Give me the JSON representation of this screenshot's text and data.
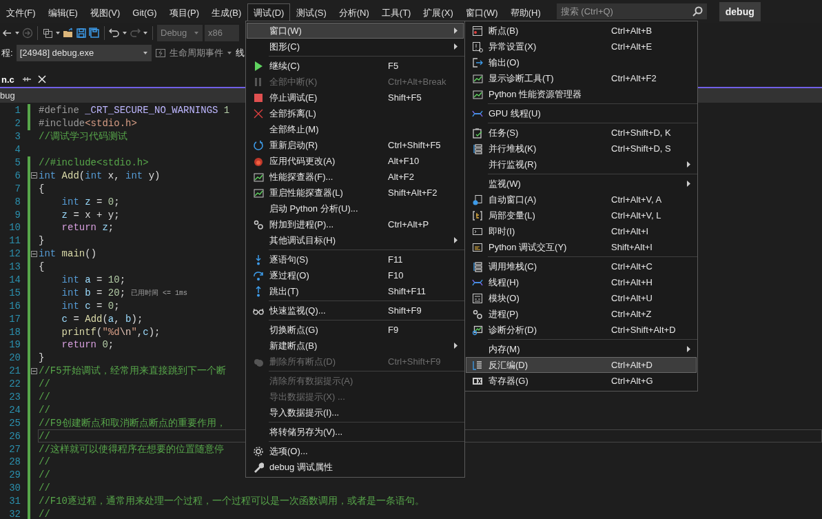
{
  "menu_bar": {
    "items": [
      {
        "label": "文件(F)",
        "selected": false
      },
      {
        "label": "编辑(E)",
        "selected": false
      },
      {
        "label": "视图(V)",
        "selected": false
      },
      {
        "label": "Git(G)",
        "selected": false
      },
      {
        "label": "项目(P)",
        "selected": false
      },
      {
        "label": "生成(B)",
        "selected": false
      },
      {
        "label": "调试(D)",
        "selected": true
      },
      {
        "label": "测试(S)",
        "selected": false
      },
      {
        "label": "分析(N)",
        "selected": false
      },
      {
        "label": "工具(T)",
        "selected": false
      },
      {
        "label": "扩展(X)",
        "selected": false
      },
      {
        "label": "窗口(W)",
        "selected": false
      },
      {
        "label": "帮助(H)",
        "selected": false
      }
    ],
    "search": {
      "placeholder": "搜索 (Ctrl+Q)"
    },
    "solution": "debug"
  },
  "toolbar": {
    "buttons": [
      {
        "kind": "back",
        "disabled": false
      },
      {
        "kind": "forward",
        "disabled": true
      },
      {
        "kind": "new-project",
        "disabled": false
      },
      {
        "kind": "open",
        "disabled": false
      },
      {
        "kind": "save",
        "disabled": false
      },
      {
        "kind": "save-all",
        "disabled": false
      },
      {
        "kind": "undo",
        "disabled": false
      },
      {
        "kind": "redo",
        "disabled": true
      }
    ],
    "configuration": {
      "value": "Debug",
      "disabled": true
    },
    "platform": {
      "value": "x86",
      "disabled": true
    }
  },
  "debug_toolbar": {
    "process_label": "程:",
    "process": "[24948] debug.exe",
    "lifecycle": "生命周期事件",
    "thread_label": "线"
  },
  "tab": {
    "title": "n.c",
    "path": "bug"
  },
  "editor": {
    "lines": [
      {
        "n": "1",
        "changed": true,
        "fold": false,
        "current": false,
        "tokens": [
          {
            "text": "#define ",
            "kind": "pp"
          },
          {
            "text": "_CRT_SECURE_NO_WARNINGS",
            "kind": "macro"
          },
          {
            "text": " 1",
            "kind": "num"
          }
        ]
      },
      {
        "n": "2",
        "changed": true,
        "fold": false,
        "current": false,
        "tokens": [
          {
            "text": "#include",
            "kind": "pp"
          },
          {
            "text": "<stdio.h>",
            "kind": "str"
          }
        ]
      },
      {
        "n": "3",
        "changed": false,
        "fold": false,
        "current": false,
        "tokens": [
          {
            "text": "//调试学习代码测试",
            "kind": "cmt"
          }
        ]
      },
      {
        "n": "4",
        "changed": false,
        "fold": false,
        "current": false
      },
      {
        "n": "5",
        "changed": true,
        "fold": false,
        "current": false,
        "tokens": [
          {
            "text": "//#include<stdio.h>",
            "kind": "cmt"
          }
        ]
      },
      {
        "n": "6",
        "changed": true,
        "fold": true,
        "current": false,
        "tokens": [
          {
            "text": "int",
            "kind": "kw"
          },
          {
            "text": " Add",
            "kind": "fn"
          },
          {
            "text": "(",
            "kind": "plain"
          },
          {
            "text": "int",
            "kind": "kw"
          },
          {
            "text": " x, ",
            "kind": "plain"
          },
          {
            "text": "int",
            "kind": "kw"
          },
          {
            "text": " y)",
            "kind": "plain"
          }
        ]
      },
      {
        "n": "7",
        "changed": true,
        "fold": false,
        "current": false,
        "tokens": [
          {
            "text": "{",
            "kind": "plain"
          }
        ]
      },
      {
        "n": "8",
        "changed": true,
        "fold": false,
        "current": false,
        "tokens": [
          {
            "text": "    int",
            "kind": "kw"
          },
          {
            "text": " z",
            "kind": "var"
          },
          {
            "text": " = ",
            "kind": "plain"
          },
          {
            "text": "0",
            "kind": "num"
          },
          {
            "text": ";",
            "kind": "plain"
          }
        ]
      },
      {
        "n": "9",
        "changed": true,
        "fold": false,
        "current": false,
        "tokens": [
          {
            "text": "    z",
            "kind": "var"
          },
          {
            "text": " = x + y;",
            "kind": "plain"
          }
        ]
      },
      {
        "n": "10",
        "changed": true,
        "fold": false,
        "current": false,
        "tokens": [
          {
            "text": "    return",
            "kind": "ctl"
          },
          {
            "text": " z",
            "kind": "var"
          },
          {
            "text": ";",
            "kind": "plain"
          }
        ]
      },
      {
        "n": "11",
        "changed": true,
        "fold": false,
        "current": false,
        "tokens": [
          {
            "text": "}",
            "kind": "plain"
          }
        ]
      },
      {
        "n": "12",
        "changed": true,
        "fold": true,
        "current": false,
        "tokens": [
          {
            "text": "int",
            "kind": "kw"
          },
          {
            "text": " main",
            "kind": "fn"
          },
          {
            "text": "()",
            "kind": "plain"
          }
        ]
      },
      {
        "n": "13",
        "changed": true,
        "fold": false,
        "current": false,
        "tokens": [
          {
            "text": "{",
            "kind": "plain"
          }
        ]
      },
      {
        "n": "14",
        "changed": true,
        "fold": false,
        "current": false,
        "tokens": [
          {
            "text": "    int",
            "kind": "kw"
          },
          {
            "text": " a",
            "kind": "var"
          },
          {
            "text": " = ",
            "kind": "plain"
          },
          {
            "text": "10",
            "kind": "num"
          },
          {
            "text": ";",
            "kind": "plain"
          }
        ]
      },
      {
        "n": "15",
        "changed": true,
        "fold": false,
        "current": false,
        "hint": "已用时间 <= 1ms",
        "tokens": [
          {
            "text": "    int",
            "kind": "kw"
          },
          {
            "text": " b",
            "kind": "var"
          },
          {
            "text": " = ",
            "kind": "plain"
          },
          {
            "text": "20",
            "kind": "num"
          },
          {
            "text": ";",
            "kind": "plain"
          }
        ]
      },
      {
        "n": "16",
        "changed": true,
        "fold": false,
        "current": false,
        "tokens": [
          {
            "text": "    int",
            "kind": "kw"
          },
          {
            "text": " c",
            "kind": "var"
          },
          {
            "text": " = ",
            "kind": "plain"
          },
          {
            "text": "0",
            "kind": "num"
          },
          {
            "text": ";",
            "kind": "plain"
          }
        ]
      },
      {
        "n": "17",
        "changed": true,
        "fold": false,
        "current": false,
        "tokens": [
          {
            "text": "    c",
            "kind": "var"
          },
          {
            "text": " = ",
            "kind": "plain"
          },
          {
            "text": "Add",
            "kind": "fn"
          },
          {
            "text": "(",
            "kind": "plain"
          },
          {
            "text": "a",
            "kind": "var"
          },
          {
            "text": ", ",
            "kind": "plain"
          },
          {
            "text": "b",
            "kind": "var"
          },
          {
            "text": ");",
            "kind": "plain"
          }
        ]
      },
      {
        "n": "18",
        "changed": true,
        "fold": false,
        "current": false,
        "tokens": [
          {
            "text": "    printf",
            "kind": "fn"
          },
          {
            "text": "(",
            "kind": "plain"
          },
          {
            "text": "\"%d",
            "kind": "str"
          },
          {
            "text": "\\n",
            "kind": "esc"
          },
          {
            "text": "\"",
            "kind": "str"
          },
          {
            "text": ",",
            "kind": "plain"
          },
          {
            "text": "c",
            "kind": "var"
          },
          {
            "text": ");",
            "kind": "plain"
          }
        ]
      },
      {
        "n": "19",
        "changed": true,
        "fold": false,
        "current": false,
        "tokens": [
          {
            "text": "    return",
            "kind": "ctl"
          },
          {
            "text": " 0",
            "kind": "num"
          },
          {
            "text": ";",
            "kind": "plain"
          }
        ]
      },
      {
        "n": "20",
        "changed": true,
        "fold": false,
        "current": false,
        "tokens": [
          {
            "text": "}",
            "kind": "plain"
          }
        ]
      },
      {
        "n": "21",
        "changed": true,
        "fold": true,
        "current": false,
        "tokens": [
          {
            "text": "//F5开始调试，经常用来直接跳到下一个断",
            "kind": "cmt"
          }
        ]
      },
      {
        "n": "22",
        "changed": true,
        "fold": false,
        "current": false,
        "tokens": [
          {
            "text": "//",
            "kind": "cmt"
          }
        ]
      },
      {
        "n": "23",
        "changed": true,
        "fold": false,
        "current": false,
        "tokens": [
          {
            "text": "//",
            "kind": "cmt"
          }
        ]
      },
      {
        "n": "24",
        "changed": true,
        "fold": false,
        "current": false,
        "tokens": [
          {
            "text": "//",
            "kind": "cmt"
          }
        ]
      },
      {
        "n": "25",
        "changed": true,
        "fold": false,
        "current": false,
        "tokens": [
          {
            "text": "//F9创建断点和取消断点断点的重要作用，",
            "kind": "cmt"
          }
        ]
      },
      {
        "n": "26",
        "changed": true,
        "fold": false,
        "current": true,
        "tokens": [
          {
            "text": "//",
            "kind": "cmt"
          }
        ]
      },
      {
        "n": "27",
        "changed": true,
        "fold": false,
        "current": false,
        "tokens": [
          {
            "text": "//这样就可以使得程序在想要的位置随意停",
            "kind": "cmt"
          }
        ]
      },
      {
        "n": "28",
        "changed": true,
        "fold": false,
        "current": false,
        "tokens": [
          {
            "text": "//",
            "kind": "cmt"
          }
        ]
      },
      {
        "n": "29",
        "changed": true,
        "fold": false,
        "current": false,
        "tokens": [
          {
            "text": "//",
            "kind": "cmt"
          }
        ]
      },
      {
        "n": "30",
        "changed": true,
        "fold": false,
        "current": false,
        "tokens": [
          {
            "text": "//",
            "kind": "cmt"
          }
        ]
      },
      {
        "n": "31",
        "changed": true,
        "fold": false,
        "current": false,
        "tokens": [
          {
            "text": "//F10逐过程，通常用来处理一个过程，一个过程可以是一次函数调用，或者是一条语句。",
            "kind": "cmt"
          }
        ]
      },
      {
        "n": "32",
        "changed": true,
        "fold": false,
        "current": false,
        "tokens": [
          {
            "text": "//",
            "kind": "cmt"
          }
        ]
      }
    ]
  },
  "debug_menu": {
    "items": [
      {
        "kind": "item",
        "label": "窗口(W)",
        "submenu": true,
        "selected": true,
        "disabled": false
      },
      {
        "kind": "item",
        "label": "图形(C)",
        "submenu": true,
        "selected": false,
        "disabled": false
      },
      {
        "kind": "separator"
      },
      {
        "kind": "item",
        "label": "继续(C)",
        "shortcut": "F5",
        "submenu": false,
        "selected": false,
        "disabled": false
      },
      {
        "kind": "item",
        "label": "全部中断(K)",
        "shortcut": "Ctrl+Alt+Break",
        "submenu": false,
        "selected": false,
        "disabled": true
      },
      {
        "kind": "item",
        "label": "停止调试(E)",
        "shortcut": "Shift+F5",
        "submenu": false,
        "selected": false,
        "disabled": false
      },
      {
        "kind": "item",
        "label": "全部拆离(L)",
        "submenu": false,
        "selected": false,
        "disabled": false
      },
      {
        "kind": "item",
        "label": "全部终止(M)",
        "submenu": false,
        "selected": false,
        "disabled": false
      },
      {
        "kind": "item",
        "label": "重新启动(R)",
        "shortcut": "Ctrl+Shift+F5",
        "submenu": false,
        "selected": false,
        "disabled": false
      },
      {
        "kind": "item",
        "label": "应用代码更改(A)",
        "shortcut": "Alt+F10",
        "submenu": false,
        "selected": false,
        "disabled": false
      },
      {
        "kind": "item",
        "label": "性能探查器(F)...",
        "shortcut": "Alt+F2",
        "submenu": false,
        "selected": false,
        "disabled": false
      },
      {
        "kind": "item",
        "label": "重启性能探查器(L)",
        "shortcut": "Shift+Alt+F2",
        "submenu": false,
        "selected": false,
        "disabled": false
      },
      {
        "kind": "item",
        "label": "启动 Python 分析(U)...",
        "submenu": false,
        "selected": false,
        "disabled": false
      },
      {
        "kind": "item",
        "label": "附加到进程(P)...",
        "shortcut": "Ctrl+Alt+P",
        "submenu": false,
        "selected": false,
        "disabled": false
      },
      {
        "kind": "item",
        "label": "其他调试目标(H)",
        "submenu": true,
        "selected": false,
        "disabled": false
      },
      {
        "kind": "separator"
      },
      {
        "kind": "item",
        "label": "逐语句(S)",
        "shortcut": "F11",
        "submenu": false,
        "selected": false,
        "disabled": false
      },
      {
        "kind": "item",
        "label": "逐过程(O)",
        "shortcut": "F10",
        "submenu": false,
        "selected": false,
        "disabled": false
      },
      {
        "kind": "item",
        "label": "跳出(T)",
        "shortcut": "Shift+F11",
        "submenu": false,
        "selected": false,
        "disabled": false
      },
      {
        "kind": "separator"
      },
      {
        "kind": "item",
        "label": "快速监视(Q)...",
        "shortcut": "Shift+F9",
        "submenu": false,
        "selected": false,
        "disabled": false
      },
      {
        "kind": "separator"
      },
      {
        "kind": "item",
        "label": "切换断点(G)",
        "shortcut": "F9",
        "submenu": false,
        "selected": false,
        "disabled": false
      },
      {
        "kind": "item",
        "label": "新建断点(B)",
        "submenu": true,
        "selected": false,
        "disabled": false
      },
      {
        "kind": "item",
        "label": "删除所有断点(D)",
        "shortcut": "Ctrl+Shift+F9",
        "submenu": false,
        "selected": false,
        "disabled": true
      },
      {
        "kind": "separator"
      },
      {
        "kind": "item",
        "label": "清除所有数据提示(A)",
        "submenu": false,
        "selected": false,
        "disabled": true
      },
      {
        "kind": "item",
        "label": "导出数据提示(X) ...",
        "submenu": false,
        "selected": false,
        "disabled": true
      },
      {
        "kind": "item",
        "label": "导入数据提示(I)...",
        "submenu": false,
        "selected": false,
        "disabled": false
      },
      {
        "kind": "separator"
      },
      {
        "kind": "item",
        "label": "将转储另存为(V)...",
        "submenu": false,
        "selected": false,
        "disabled": false
      },
      {
        "kind": "separator"
      },
      {
        "kind": "item",
        "label": "选项(O)...",
        "submenu": false,
        "selected": false,
        "disabled": false
      },
      {
        "kind": "item",
        "label": "debug 调试属性",
        "submenu": false,
        "selected": false,
        "disabled": false
      }
    ]
  },
  "window_submenu": {
    "items": [
      {
        "kind": "item",
        "label": "断点(B)",
        "shortcut": "Ctrl+Alt+B",
        "submenu": false,
        "selected": false
      },
      {
        "kind": "item",
        "label": "异常设置(X)",
        "shortcut": "Ctrl+Alt+E",
        "submenu": false,
        "selected": false
      },
      {
        "kind": "item",
        "label": "输出(O)",
        "submenu": false,
        "selected": false
      },
      {
        "kind": "item",
        "label": "显示诊断工具(T)",
        "shortcut": "Ctrl+Alt+F2",
        "submenu": false,
        "selected": false
      },
      {
        "kind": "item",
        "label": "Python 性能资源管理器",
        "submenu": false,
        "selected": false
      },
      {
        "kind": "separator"
      },
      {
        "kind": "item",
        "label": "GPU 线程(U)",
        "submenu": false,
        "selected": false
      },
      {
        "kind": "separator"
      },
      {
        "kind": "item",
        "label": "任务(S)",
        "shortcut": "Ctrl+Shift+D, K",
        "submenu": false,
        "selected": false
      },
      {
        "kind": "item",
        "label": "并行堆栈(K)",
        "shortcut": "Ctrl+Shift+D, S",
        "submenu": false,
        "selected": false
      },
      {
        "kind": "item",
        "label": "并行监视(R)",
        "submenu": true,
        "selected": false
      },
      {
        "kind": "separator"
      },
      {
        "kind": "item",
        "label": "监视(W)",
        "submenu": true,
        "selected": false
      },
      {
        "kind": "item",
        "label": "自动窗口(A)",
        "shortcut": "Ctrl+Alt+V, A",
        "submenu": false,
        "selected": false
      },
      {
        "kind": "item",
        "label": "局部变量(L)",
        "shortcut": "Ctrl+Alt+V, L",
        "submenu": false,
        "selected": false
      },
      {
        "kind": "item",
        "label": "即时(I)",
        "shortcut": "Ctrl+Alt+I",
        "submenu": false,
        "selected": false
      },
      {
        "kind": "item",
        "label": "Python 调试交互(Y)",
        "shortcut": "Shift+Alt+I",
        "submenu": false,
        "selected": false
      },
      {
        "kind": "separator"
      },
      {
        "kind": "item",
        "label": "调用堆栈(C)",
        "shortcut": "Ctrl+Alt+C",
        "submenu": false,
        "selected": false
      },
      {
        "kind": "item",
        "label": "线程(H)",
        "shortcut": "Ctrl+Alt+H",
        "submenu": false,
        "selected": false
      },
      {
        "kind": "item",
        "label": "模块(O)",
        "shortcut": "Ctrl+Alt+U",
        "submenu": false,
        "selected": false
      },
      {
        "kind": "item",
        "label": "进程(P)",
        "shortcut": "Ctrl+Alt+Z",
        "submenu": false,
        "selected": false
      },
      {
        "kind": "item",
        "label": "诊断分析(D)",
        "shortcut": "Ctrl+Shift+Alt+D",
        "submenu": false,
        "selected": false
      },
      {
        "kind": "separator"
      },
      {
        "kind": "item",
        "label": "内存(M)",
        "submenu": true,
        "selected": false
      },
      {
        "kind": "item",
        "label": "反汇编(D)",
        "shortcut": "Ctrl+Alt+D",
        "submenu": false,
        "selected": true
      },
      {
        "kind": "item",
        "label": "寄存器(G)",
        "shortcut": "Ctrl+Alt+G",
        "submenu": false,
        "selected": false
      }
    ]
  }
}
